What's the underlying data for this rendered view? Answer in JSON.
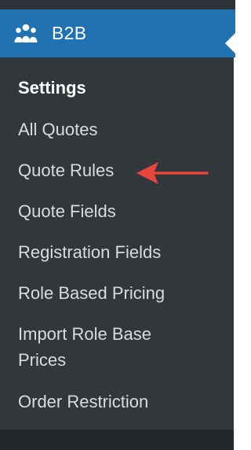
{
  "menu": {
    "title": "B2B",
    "icon": "users-group-icon",
    "items": [
      {
        "label": "Settings",
        "active": true
      },
      {
        "label": "All Quotes"
      },
      {
        "label": "Quote Rules"
      },
      {
        "label": "Quote Fields"
      },
      {
        "label": "Registration Fields"
      },
      {
        "label": "Role Based Pricing"
      },
      {
        "label": "Import Role Base Prices"
      },
      {
        "label": "Order Restriction"
      }
    ]
  },
  "annotation": {
    "icon": "red-arrow-icon",
    "color": "#e8453c"
  },
  "colors": {
    "header_bg": "#2271b1",
    "submenu_bg": "#32373c",
    "outer_bg": "#2c3338",
    "text": "#d8dcdf",
    "active_text": "#ffffff"
  }
}
